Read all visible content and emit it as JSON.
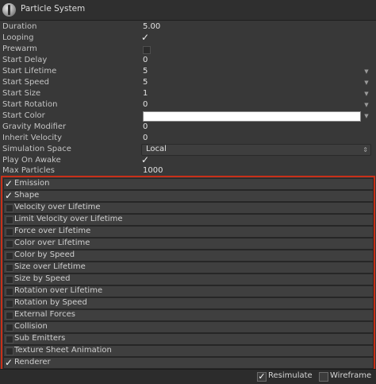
{
  "header": {
    "title": "Particle System"
  },
  "properties": {
    "duration": {
      "label": "Duration",
      "value": "5.00"
    },
    "looping": {
      "label": "Looping",
      "checked": true
    },
    "prewarm": {
      "label": "Prewarm",
      "checked": false
    },
    "start_delay": {
      "label": "Start Delay",
      "value": "0"
    },
    "start_lifetime": {
      "label": "Start Lifetime",
      "value": "5"
    },
    "start_speed": {
      "label": "Start Speed",
      "value": "5"
    },
    "start_size": {
      "label": "Start Size",
      "value": "1"
    },
    "start_rotation": {
      "label": "Start Rotation",
      "value": "0"
    },
    "start_color": {
      "label": "Start Color",
      "color": "#ffffff"
    },
    "gravity_modifier": {
      "label": "Gravity Modifier",
      "value": "0"
    },
    "inherit_velocity": {
      "label": "Inherit Velocity",
      "value": "0"
    },
    "simulation_space": {
      "label": "Simulation Space",
      "value": "Local"
    },
    "play_on_awake": {
      "label": "Play On Awake",
      "checked": true
    },
    "max_particles": {
      "label": "Max Particles",
      "value": "1000"
    }
  },
  "modules": [
    {
      "label": "Emission",
      "enabled": true
    },
    {
      "label": "Shape",
      "enabled": true
    },
    {
      "label": "Velocity over Lifetime",
      "enabled": false
    },
    {
      "label": "Limit Velocity over Lifetime",
      "enabled": false
    },
    {
      "label": "Force over Lifetime",
      "enabled": false
    },
    {
      "label": "Color over Lifetime",
      "enabled": false
    },
    {
      "label": "Color by Speed",
      "enabled": false
    },
    {
      "label": "Size over Lifetime",
      "enabled": false
    },
    {
      "label": "Size by Speed",
      "enabled": false
    },
    {
      "label": "Rotation over Lifetime",
      "enabled": false
    },
    {
      "label": "Rotation by Speed",
      "enabled": false
    },
    {
      "label": "External Forces",
      "enabled": false
    },
    {
      "label": "Collision",
      "enabled": false
    },
    {
      "label": "Sub Emitters",
      "enabled": false
    },
    {
      "label": "Texture Sheet Animation",
      "enabled": false
    },
    {
      "label": "Renderer",
      "enabled": true
    }
  ],
  "footer": {
    "resimulate_label": "Resimulate",
    "resimulate_checked": true,
    "wireframe_label": "Wireframe",
    "wireframe_checked": false
  },
  "colors": {
    "highlight_border": "#c93019",
    "panel_bg": "#383838"
  }
}
